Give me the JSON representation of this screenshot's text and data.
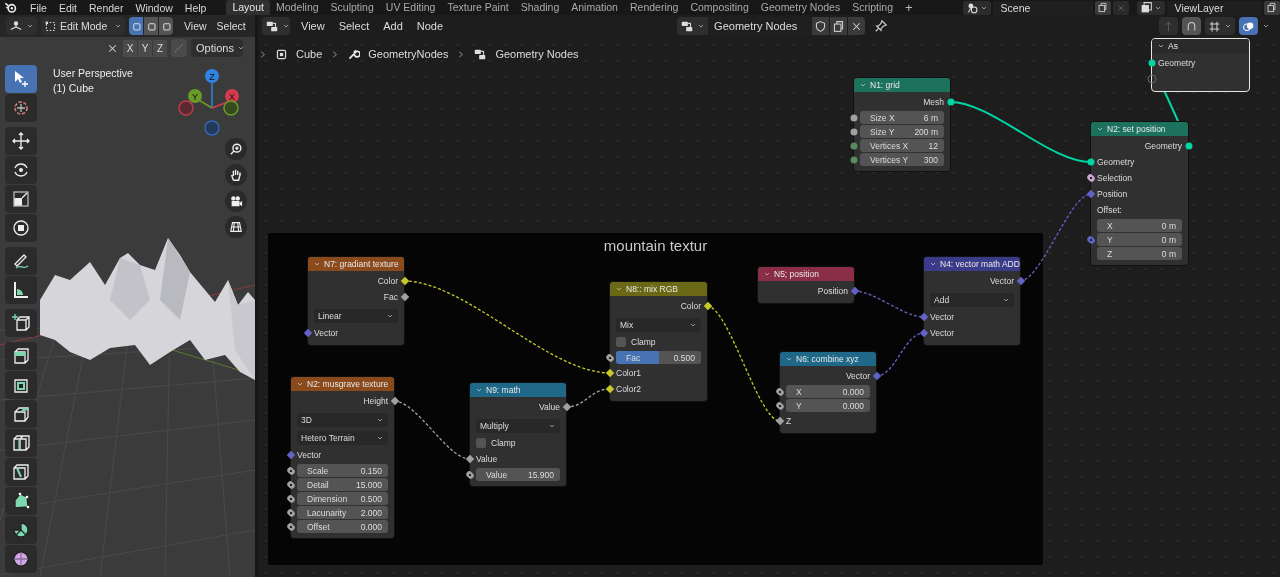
{
  "topbar": {
    "menus": [
      "File",
      "Edit",
      "Render",
      "Window",
      "Help"
    ],
    "workspaces": [
      {
        "label": "Layout",
        "selected": true
      },
      {
        "label": "Modeling",
        "selected": false
      },
      {
        "label": "Sculpting",
        "selected": false
      },
      {
        "label": "UV Editing",
        "selected": false
      },
      {
        "label": "Texture Paint",
        "selected": false
      },
      {
        "label": "Shading",
        "selected": false
      },
      {
        "label": "Animation",
        "selected": false
      },
      {
        "label": "Rendering",
        "selected": false
      },
      {
        "label": "Compositing",
        "selected": false
      },
      {
        "label": "Geometry Nodes",
        "selected": false
      },
      {
        "label": "Scripting",
        "selected": false
      }
    ],
    "add_tab": "+",
    "scene": "Scene",
    "view_layer": "ViewLayer"
  },
  "viewport": {
    "mode": "Edit Mode",
    "select_modes": [
      {
        "selected": true
      },
      {
        "selected": false
      },
      {
        "selected": false
      }
    ],
    "menus": [
      "View",
      "Select"
    ],
    "axes": [
      "X",
      "Y",
      "Z"
    ],
    "options": "Options",
    "info": [
      "User Perspective",
      "(1) Cube"
    ],
    "gizmo": {
      "z": "Z",
      "y": "Y",
      "x": "X"
    },
    "tools": [
      {
        "selected": true
      },
      {
        "selected": false
      },
      {
        "selected": false
      },
      {
        "selected": false
      },
      {
        "selected": false
      },
      {
        "selected": false
      },
      {
        "selected": false
      },
      {
        "selected": false
      },
      {
        "selected": false
      },
      {
        "selected": false
      },
      {
        "selected": false
      },
      {
        "selected": false
      },
      {
        "selected": false
      },
      {
        "selected": false
      },
      {
        "selected": false
      },
      {
        "selected": false
      },
      {
        "selected": false
      }
    ]
  },
  "node_editor": {
    "menus": [
      "View",
      "Select",
      "Add",
      "Node"
    ],
    "tree_name": "Geometry Nodes",
    "breadcrumbs": [
      "Cube",
      "GeometryNodes",
      "Geometry Nodes"
    ],
    "frame": {
      "label": "mountain textur"
    },
    "nodes": [
      {
        "title": "As",
        "color": "#2a2a2a",
        "selected": true,
        "rows": [
          {
            "kind": "input",
            "label": "Geometry",
            "socket": {
              "kind": "geometry"
            }
          },
          {
            "kind": "input",
            "socket": {
              "kind": "empty"
            }
          }
        ]
      },
      {
        "title": "N1: grid",
        "color": "#1d725e",
        "selected": false,
        "rows": [
          {
            "kind": "output",
            "label": "Mesh",
            "socket": {
              "kind": "geometry"
            }
          },
          {
            "kind": "field",
            "label": "Size X",
            "value": "6 m",
            "socket": {
              "kind": "float_single"
            }
          },
          {
            "kind": "field",
            "label": "Size Y",
            "value": "200 m",
            "socket": {
              "kind": "float_single"
            }
          },
          {
            "kind": "field",
            "label": "Vertices X",
            "value": "12",
            "socket": {
              "kind": "int"
            }
          },
          {
            "kind": "field",
            "label": "Vertices Y",
            "value": "300",
            "socket": {
              "kind": "int"
            }
          }
        ]
      },
      {
        "title": "N2: set position",
        "color": "#1d725e",
        "selected": false,
        "rows": [
          {
            "kind": "output",
            "label": "Geometry",
            "socket": {
              "kind": "geometry"
            }
          },
          {
            "kind": "input",
            "label": "Geometry",
            "socket": {
              "kind": "geometry"
            }
          },
          {
            "kind": "input",
            "label": "Selection",
            "socket": {
              "kind": "bool_field"
            }
          },
          {
            "kind": "input",
            "label": "Position",
            "socket": {
              "kind": "vector"
            }
          },
          {
            "kind": "label",
            "label": "Offset:"
          },
          {
            "kind": "field",
            "label": "X",
            "value": "0 m"
          },
          {
            "kind": "field",
            "label": "Y",
            "value": "0 m",
            "socket": {
              "kind": "vector_field"
            }
          },
          {
            "kind": "field",
            "label": "Z",
            "value": "0 m"
          }
        ]
      },
      {
        "title": "N7: gradiant texture",
        "color": "#8b4a1c",
        "selected": false,
        "rows": [
          {
            "kind": "output",
            "label": "Color",
            "socket": {
              "kind": "color"
            }
          },
          {
            "kind": "output",
            "label": "Fac",
            "socket": {
              "kind": "float"
            }
          },
          {
            "kind": "dropdown",
            "value": "Linear"
          },
          {
            "kind": "input",
            "label": "Vector",
            "socket": {
              "kind": "vector"
            }
          }
        ]
      },
      {
        "title": "N5; position",
        "color": "#8a2d47",
        "selected": false,
        "rows": [
          {
            "kind": "output",
            "label": "Position",
            "socket": {
              "kind": "vector"
            }
          }
        ]
      },
      {
        "title": "N4: vector math ADD",
        "color": "#3c3b8a",
        "selected": false,
        "rows": [
          {
            "kind": "output",
            "label": "Vector",
            "socket": {
              "kind": "vector"
            }
          },
          {
            "kind": "dropdown",
            "value": "Add"
          },
          {
            "kind": "input",
            "label": "Vector",
            "socket": {
              "kind": "vector"
            }
          },
          {
            "kind": "input",
            "label": "Vector",
            "socket": {
              "kind": "vector"
            }
          }
        ]
      },
      {
        "title": "N8:: mix RGB",
        "color": "#6b6916",
        "selected": false,
        "rows": [
          {
            "kind": "output",
            "label": "Color",
            "socket": {
              "kind": "color"
            }
          },
          {
            "kind": "dropdown",
            "value": "Mix"
          },
          {
            "kind": "checkbox",
            "label": "Clamp",
            "checked": false
          },
          {
            "kind": "slider",
            "label": "Fac",
            "value": "0.500",
            "level": 0.5,
            "socket": {
              "kind": "float_field"
            }
          },
          {
            "kind": "input",
            "label": "Color1",
            "socket": {
              "kind": "color"
            }
          },
          {
            "kind": "input",
            "label": "Color2",
            "socket": {
              "kind": "color"
            }
          }
        ]
      },
      {
        "title": "N6: combine xyz",
        "color": "#1f6887",
        "selected": false,
        "rows": [
          {
            "kind": "output",
            "label": "Vector",
            "socket": {
              "kind": "vector"
            }
          },
          {
            "kind": "field",
            "label": "X",
            "value": "0.000",
            "socket": {
              "kind": "float_field"
            }
          },
          {
            "kind": "field",
            "label": "Y",
            "value": "0.000",
            "socket": {
              "kind": "float_field"
            }
          },
          {
            "kind": "input",
            "label": "Z",
            "socket": {
              "kind": "float"
            }
          }
        ]
      },
      {
        "title": "N2: musgrave texture",
        "color": "#8b4a1c",
        "selected": false,
        "rows": [
          {
            "kind": "output",
            "label": "Height",
            "socket": {
              "kind": "float"
            }
          },
          {
            "kind": "dropdown",
            "value": "3D"
          },
          {
            "kind": "dropdown",
            "value": "Hetero Terrain"
          },
          {
            "kind": "input",
            "label": "Vector",
            "socket": {
              "kind": "vector"
            }
          },
          {
            "kind": "field",
            "label": "Scale",
            "value": "0.150",
            "socket": {
              "kind": "float_field"
            }
          },
          {
            "kind": "field",
            "label": "Detail",
            "value": "15.000",
            "socket": {
              "kind": "float_field"
            }
          },
          {
            "kind": "field",
            "label": "Dimension",
            "value": "0.500",
            "socket": {
              "kind": "float_field"
            }
          },
          {
            "kind": "field",
            "label": "Lacunarity",
            "value": "2.000",
            "socket": {
              "kind": "float_field"
            }
          },
          {
            "kind": "field",
            "label": "Offset",
            "value": "0.000",
            "socket": {
              "kind": "float_field"
            }
          }
        ]
      },
      {
        "title": "N9: math",
        "color": "#1f6887",
        "selected": false,
        "rows": [
          {
            "kind": "output",
            "label": "Value",
            "socket": {
              "kind": "float"
            }
          },
          {
            "kind": "dropdown",
            "value": "Multiply"
          },
          {
            "kind": "checkbox",
            "label": "Clamp",
            "checked": false
          },
          {
            "kind": "input",
            "label": "Value",
            "socket": {
              "kind": "float"
            }
          },
          {
            "kind": "field",
            "label": "Value",
            "value": "15.900",
            "socket": {
              "kind": "float_field"
            }
          }
        ]
      }
    ]
  }
}
